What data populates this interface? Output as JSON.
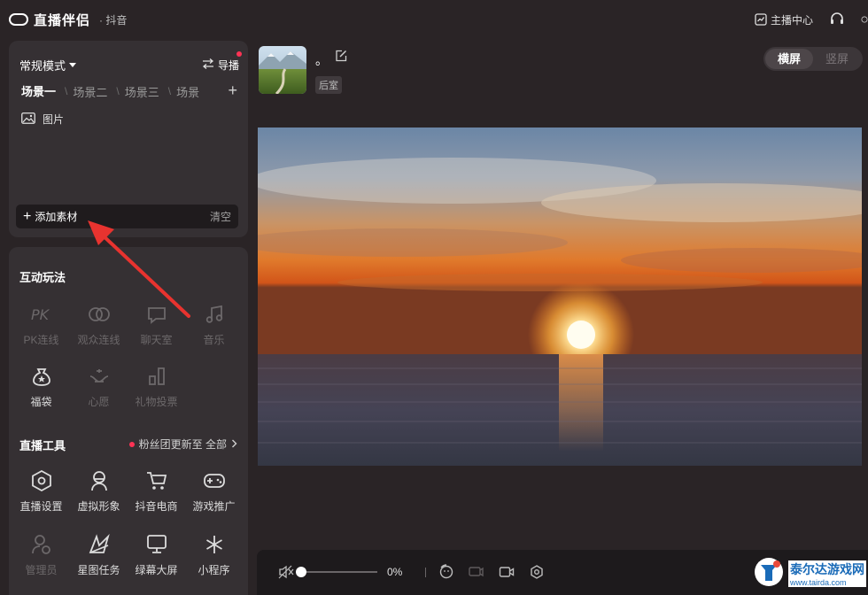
{
  "header": {
    "app_name": "直播伴侣",
    "platform": "· 抖音",
    "creator_center": "主播中心"
  },
  "scene_panel": {
    "mode": "常规模式",
    "director": "导播",
    "tabs": [
      "场景一",
      "场景二",
      "场景三",
      "场景"
    ],
    "active_tab": 0,
    "sources": [
      {
        "label": "图片"
      }
    ],
    "add_material": "添加素材",
    "clear": "清空"
  },
  "interact": {
    "title": "互动玩法",
    "items": [
      {
        "label": "PK连线",
        "state": "disabled"
      },
      {
        "label": "观众连线",
        "state": "disabled"
      },
      {
        "label": "聊天室",
        "state": "disabled"
      },
      {
        "label": "音乐",
        "state": "disabled"
      },
      {
        "label": "福袋",
        "state": "enabled"
      },
      {
        "label": "心愿",
        "state": "disabled"
      },
      {
        "label": "礼物投票",
        "state": "disabled"
      }
    ]
  },
  "tools": {
    "title": "直播工具",
    "fans_link": "粉丝团更新至 全部",
    "items": [
      {
        "label": "直播设置",
        "state": "enabled"
      },
      {
        "label": "虚拟形象",
        "state": "enabled"
      },
      {
        "label": "抖音电商",
        "state": "enabled"
      },
      {
        "label": "游戏推广",
        "state": "enabled"
      },
      {
        "label": "管理员",
        "state": "disabled"
      },
      {
        "label": "星图任务",
        "state": "enabled"
      },
      {
        "label": "绿幕大屏",
        "state": "enabled"
      },
      {
        "label": "小程序",
        "state": "enabled"
      }
    ]
  },
  "room": {
    "name": "。",
    "badge": "后室"
  },
  "orientation": {
    "landscape": "横屏",
    "portrait": "竖屏",
    "selected": "landscape"
  },
  "controls": {
    "volume_percent": "0%",
    "volume_value": 0
  },
  "watermark": {
    "name": "泰尔达游戏网",
    "url": "www.tairda.com"
  },
  "colors": {
    "background": "#2a2426",
    "panel": "#353033",
    "accent_red": "#ff3355",
    "annotation_arrow": "#e8332f"
  }
}
